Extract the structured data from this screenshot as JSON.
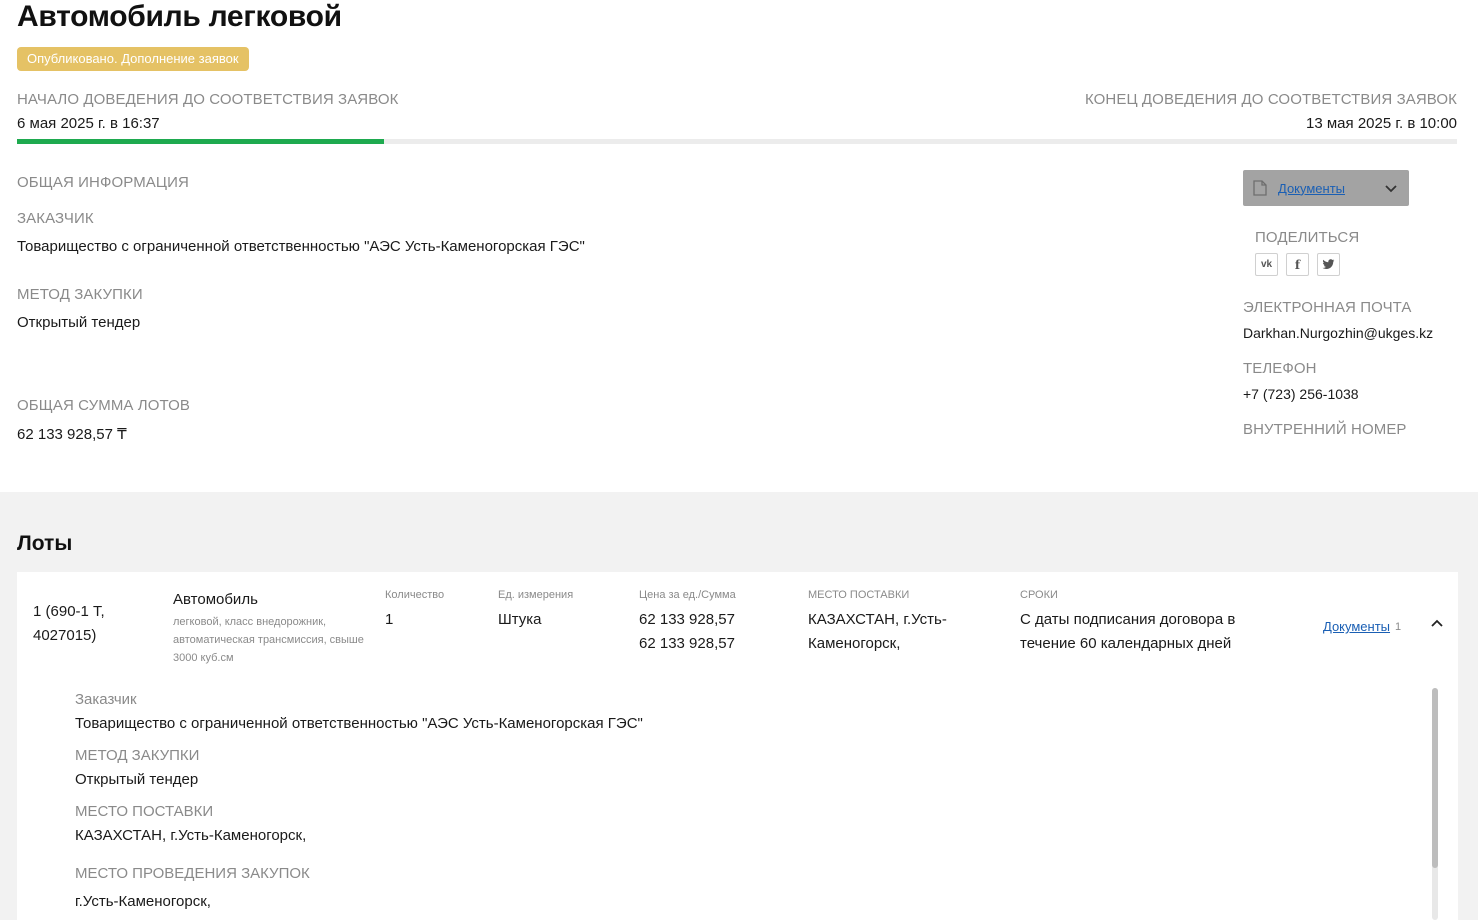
{
  "header": {
    "title": "Автомобиль легковой",
    "status_badge": "Опубликовано. Дополнение заявок"
  },
  "timeline": {
    "start_label": "НАЧАЛО ДОВЕДЕНИЯ ДО СООТВЕТСТВИЯ ЗАЯВОК",
    "start_value": "6 мая 2025 г. в 16:37",
    "end_label": "КОНЕЦ ДОВЕДЕНИЯ ДО СООТВЕТСТВИЯ ЗАЯВОК",
    "end_value": "13 мая 2025 г. в 10:00",
    "progress_fraction": 0.255,
    "progress_color": "#1eaa4f"
  },
  "general": {
    "section_label": "ОБЩАЯ ИНФОРМАЦИЯ",
    "customer_label": "ЗАКАЗЧИК",
    "customer_value": "Товарищество с ограниченной ответственностью \"АЭС Усть-Каменогорская ГЭС\"",
    "method_label": "МЕТОД ЗАКУПКИ",
    "method_value": "Открытый тендер",
    "sum_label": "ОБЩАЯ СУММА ЛОТОВ",
    "sum_value": "62 133 928,57 ₸"
  },
  "sidebar": {
    "documents_label": "Документы",
    "share_label": "ПОДЕЛИТЬСЯ",
    "social": [
      {
        "name": "vk-icon",
        "glyph": "vk"
      },
      {
        "name": "facebook-icon",
        "glyph": "f"
      },
      {
        "name": "twitter-icon",
        "glyph": "t"
      }
    ],
    "email_label": "ЭЛЕКТРОННАЯ ПОЧТА",
    "email_value": "Darkhan.Nurgozhin@ukges.kz",
    "phone_label": "ТЕЛЕФОН",
    "phone_value": "+7 (723) 256-1038",
    "inner_number_label": "ВНУТРЕННИЙ НОМЕР"
  },
  "lots": {
    "title": "Лоты",
    "items": [
      {
        "number_line1": "1 (690-1 Т,",
        "number_line2": "4027015)",
        "name": "Автомобиль",
        "description": "легковой, класс внедорожник, автоматическая трансмиссия, свыше 3000 куб.см",
        "quantity_header": "Количество",
        "quantity": "1",
        "unit_header": "Ед. измерения",
        "unit": "Штука",
        "price_header": "Цена за ед./Сумма",
        "unit_price": "62 133 928,57",
        "total": "62 133 928,57",
        "place_header": "МЕСТО ПОСТАВКИ",
        "place_line1": "КАЗАХСТАН, г.Усть-",
        "place_line2": "Каменогорск,",
        "terms_header": "СРОКИ",
        "terms_line1": "С даты подписания договора в",
        "terms_line2": "течение 60 календарных дней",
        "documents_label": "Документы",
        "documents_count": "1",
        "details": {
          "customer_label": "Заказчик",
          "customer_value": "Товарищество с ограниченной ответственностью \"АЭС Усть-Каменогорская ГЭС\"",
          "method_label": "МЕТОД ЗАКУПКИ",
          "method_value": "Открытый тендер",
          "delivery_label": "МЕСТО ПОСТАВКИ",
          "delivery_value": "КАЗАХСТАН, г.Усть-Каменогорск,",
          "procurement_place_label": "МЕСТО ПРОВЕДЕНИЯ ЗАКУПОК",
          "procurement_place_value": "г.Усть-Каменогорск,"
        }
      }
    ]
  }
}
